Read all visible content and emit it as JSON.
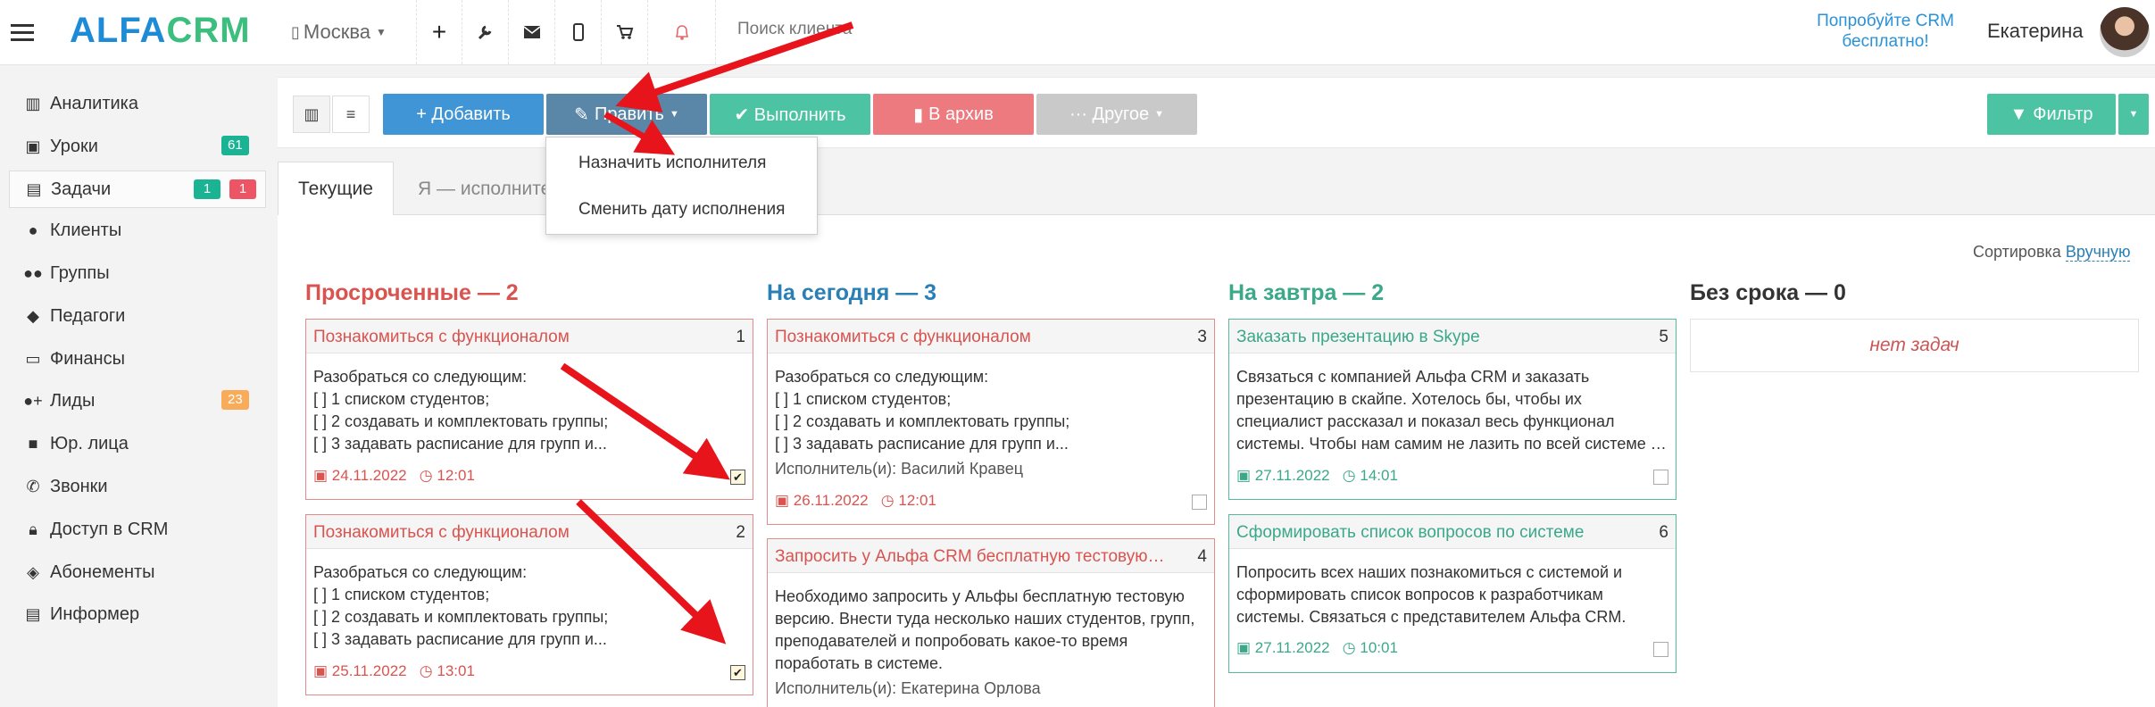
{
  "header": {
    "logo_part1": "ALFA",
    "logo_part2": "CRM",
    "city": "Москва",
    "search_placeholder": "Поиск клиента",
    "try_free": "Попробуйте CRM бесплатно!",
    "user_name": "Екатерина"
  },
  "sidebar": {
    "items": [
      {
        "label": "Аналитика",
        "icon": "book-icon"
      },
      {
        "label": "Уроки",
        "icon": "calendar-icon",
        "badge": "61"
      },
      {
        "label": "Задачи",
        "icon": "clipboard-icon",
        "badge1": "1",
        "badge2": "1"
      },
      {
        "label": "Клиенты",
        "icon": "user-icon"
      },
      {
        "label": "Группы",
        "icon": "users-icon"
      },
      {
        "label": "Педагоги",
        "icon": "graduation-cap-icon"
      },
      {
        "label": "Финансы",
        "icon": "money-icon"
      },
      {
        "label": "Лиды",
        "icon": "user-plus-icon",
        "badge": "23"
      },
      {
        "label": "Юр. лица",
        "icon": "briefcase-icon"
      },
      {
        "label": "Звонки",
        "icon": "phone-icon"
      },
      {
        "label": "Доступ в CRM",
        "icon": "lock-icon"
      },
      {
        "label": "Абонементы",
        "icon": "tag-icon"
      },
      {
        "label": "Информер",
        "icon": "list-icon"
      }
    ]
  },
  "toolbar": {
    "add": "+ Добавить",
    "edit": "Править",
    "complete": "✔ Выполнить",
    "archive": "В архив",
    "other": "··· Другое",
    "filter": "Фильтр"
  },
  "dropdown": {
    "assign": "Назначить исполнителя",
    "change_date": "Сменить дату исполнения"
  },
  "tabs": {
    "current": "Текущие",
    "mine": "Я — исполнитель"
  },
  "sort": {
    "label": "Сортировка",
    "value": "Вручную"
  },
  "columns": {
    "overdue": "Просроченные — 2",
    "today": "На сегодня — 3",
    "tomorrow": "На завтра — 2",
    "nodate": "Без срока — 0",
    "no_tasks": "нет задач"
  },
  "cards": {
    "c1": {
      "title": "Познакомиться с функционалом",
      "num": "1",
      "lines": [
        "Разобраться со следующим:",
        "[ ] 1 списком студентов;",
        "[ ] 2 создавать и комплектовать группы;",
        "[ ] 3 задавать расписание для групп и..."
      ],
      "date": "24.11.2022",
      "time": "12:01"
    },
    "c2": {
      "title": "Познакомиться с функционалом",
      "num": "2",
      "lines": [
        "Разобраться со следующим:",
        "[ ] 1 списком студентов;",
        "[ ] 2 создавать и комплектовать группы;",
        "[ ] 3 задавать расписание для групп и..."
      ],
      "date": "25.11.2022",
      "time": "13:01"
    },
    "c3": {
      "title": "Познакомиться с функционалом",
      "num": "3",
      "lines": [
        "Разобраться со следующим:",
        "[ ] 1 списком студентов;",
        "[ ] 2 создавать и комплектовать группы;",
        "[ ] 3 задавать расписание для групп и..."
      ],
      "exec": "Исполнитель(и): Василий Кравец",
      "date": "26.11.2022",
      "time": "12:01"
    },
    "c4": {
      "title": "Запросить у Альфа CRM бесплатную тестовую версию",
      "num": "4",
      "lines": [
        "Необходимо запросить у Альфы бесплатную тестовую",
        "версию. Внести туда несколько наших студентов, групп,",
        "преподавателей и попробовать какое-то время",
        "поработать в системе."
      ],
      "exec": "Исполнитель(и): Екатерина Орлова"
    },
    "c5": {
      "title": "Заказать презентацию в Skype",
      "num": "5",
      "lines": [
        "Связаться с компанией Альфа CRM и заказать",
        "презентацию в скайпе. Хотелось бы, чтобы их",
        "специалист рассказал и показал весь функционал",
        "системы. Чтобы нам самим не лазить по всей системе в..."
      ],
      "date": "27.11.2022",
      "time": "14:01"
    },
    "c6": {
      "title": "Сформировать список вопросов по системе",
      "num": "6",
      "lines": [
        "Попросить всех наших познакомиться с системой и",
        "сформировать список вопросов к разработчикам",
        "системы. Связаться с представителем Альфа CRM."
      ],
      "date": "27.11.2022",
      "time": "10:01"
    }
  },
  "colors": {
    "overdue": "#d9534f",
    "today": "#2a7fb5",
    "tomorrow": "#3aa889",
    "add_btn": "#3f95d6",
    "edit_btn": "#5a86a8",
    "complete_btn": "#4cc3a2",
    "archive_btn": "#ec7a7f",
    "other_btn": "#c9c9c9",
    "filter_btn": "#4cc3a2"
  }
}
